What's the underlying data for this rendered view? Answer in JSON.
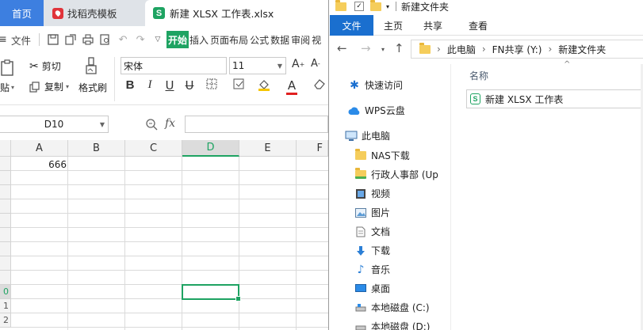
{
  "wps": {
    "tabs": {
      "home": "首页",
      "daoke": "找稻壳模板",
      "doc": "新建 XLSX 工作表.xlsx"
    },
    "menu": {
      "file": "文件"
    },
    "ribbon_tabs": [
      "开始",
      "插入",
      "页面布局",
      "公式",
      "数据",
      "审阅",
      "视"
    ],
    "ribbon": {
      "cut": "剪切",
      "copy": "复制",
      "paste": "粘贴",
      "format_painter": "格式刷",
      "font": "宋体",
      "size": "11"
    },
    "namebox": "D10",
    "fx": "fx",
    "columns": [
      "A",
      "B",
      "C",
      "D",
      "E",
      "F"
    ],
    "selected_column": "D",
    "rows": [
      "",
      "",
      "",
      "",
      "",
      "",
      "",
      "",
      "",
      "0",
      "1",
      "2"
    ],
    "cell_value": "666",
    "accent": "#1ea362",
    "tab_active_color": "#3d7fe0"
  },
  "explorer": {
    "title": "新建文件夹",
    "ribbon_tabs": {
      "file": "文件",
      "home": "主页",
      "share": "共享",
      "view": "查看"
    },
    "breadcrumb": [
      "此电脑",
      "FN共享 (Y:)",
      "新建文件夹"
    ],
    "nav": [
      {
        "label": "快速访问",
        "icon": "star-icon"
      },
      {
        "label": "WPS云盘",
        "icon": "cloud-icon"
      },
      {
        "label": "此电脑",
        "icon": "computer-icon"
      },
      {
        "label": "NAS下载",
        "icon": "folder-icon"
      },
      {
        "label": "行政人事部 (Up",
        "icon": "shared-folder-icon"
      },
      {
        "label": "视频",
        "icon": "video-icon"
      },
      {
        "label": "图片",
        "icon": "picture-icon"
      },
      {
        "label": "文档",
        "icon": "document-icon"
      },
      {
        "label": "下载",
        "icon": "download-icon"
      },
      {
        "label": "音乐",
        "icon": "music-icon"
      },
      {
        "label": "桌面",
        "icon": "desktop-icon"
      },
      {
        "label": "本地磁盘 (C:)",
        "icon": "drive-icon"
      },
      {
        "label": "本地磁盘 (D:)",
        "icon": "drive-icon"
      }
    ],
    "column_header": "名称",
    "file": "新建 XLSX 工作表",
    "accent": "#1a6fcf"
  }
}
